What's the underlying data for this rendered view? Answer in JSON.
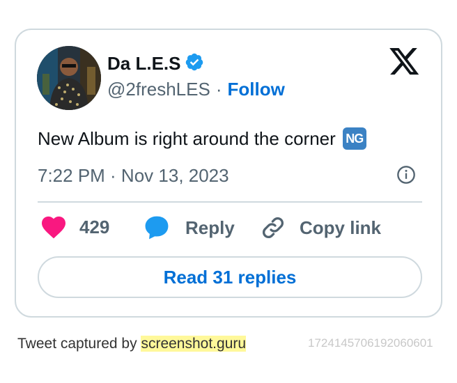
{
  "author": {
    "display_name": "Da L.E.S",
    "handle": "@2freshLES",
    "separator": "·",
    "follow_label": "Follow"
  },
  "tweet": {
    "text": "New Album is right around the corner",
    "emoji": "NG",
    "timestamp": "7:22 PM · Nov 13, 2023"
  },
  "actions": {
    "likes_count": "429",
    "reply_label": "Reply",
    "copy_label": "Copy link"
  },
  "read_replies_label": "Read 31 replies",
  "footer": {
    "prefix": "Tweet captured by",
    "brand": "screenshot.guru",
    "tweet_id": "1724145706192060601"
  },
  "colors": {
    "link": "#006fd6",
    "verified": "#1d9bf0",
    "like": "#f91880",
    "reply": "#1d9bf0",
    "border": "#cfd9de",
    "muted": "#536471"
  }
}
